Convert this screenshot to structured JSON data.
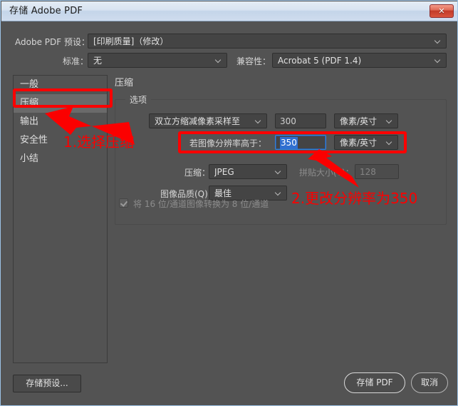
{
  "window": {
    "title": "存储 Adobe PDF",
    "close_label": "✕",
    "close_icon": "close-icon"
  },
  "header": {
    "preset_label": "Adobe PDF 预设：",
    "preset_value": "[印刷质量]（修改）",
    "standard_label": "标准：",
    "standard_value": "无",
    "compatibility_label": "兼容性：",
    "compatibility_value": "Acrobat 5 (PDF 1.4)"
  },
  "sidebar": {
    "items": [
      {
        "label": "一般",
        "selected": false
      },
      {
        "label": "压缩",
        "selected": true
      },
      {
        "label": "输出",
        "selected": false
      },
      {
        "label": "安全性",
        "selected": false
      },
      {
        "label": "小结",
        "selected": false
      }
    ]
  },
  "panel": {
    "title": "压缩",
    "group_legend": "选项",
    "downsample_method": "双立方缩减像素采样至",
    "downsample_value": "300",
    "downsample_unit": "像素/英寸",
    "threshold_label": "若图像分辨率高于：",
    "threshold_value": "350",
    "threshold_unit": "像素/英寸",
    "compression_label": "压缩：",
    "compression_value": "JPEG",
    "tile_label": "拼贴大小(T)：",
    "tile_value": "128",
    "quality_label": "图像品质(Q)：",
    "quality_value": "最佳",
    "convert16to8_label": "将 16 位/通道图像转换为 8 位/通道"
  },
  "footer": {
    "save_preset_label": "存储预设...",
    "save_pdf_label": "存储 PDF",
    "cancel_label": "取消"
  },
  "annotations": {
    "step1_text": "1.选择压缩",
    "step2_text": "2.更改分辨率为350"
  },
  "colors": {
    "dialog_background": "#535353",
    "field_background": "#444444",
    "selection_blue": "#2f6fd0",
    "annotation_red": "#fb0000",
    "titlebar_border": "#9dc3e6"
  }
}
